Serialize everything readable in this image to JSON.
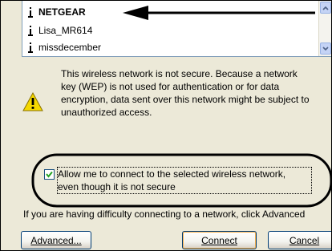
{
  "networks": [
    {
      "name": "NETGEAR",
      "selected": true
    },
    {
      "name": "Lisa_MR614",
      "selected": false
    },
    {
      "name": "missdecember",
      "selected": false
    }
  ],
  "warning": {
    "icon": "warning-icon",
    "text": "This wireless network is not secure. Because a network\nkey (WEP) is not used for authentication or for data\nencryption, data sent over this network might be subject to\nunauthorized access."
  },
  "allow": {
    "checked": true,
    "label": "Allow me to connect to the selected wireless network,\neven though it is not secure"
  },
  "help_text": "If you are having difficulty connecting to a network, click Advanced",
  "buttons": {
    "advanced": "Advanced...",
    "connect": "Connect",
    "cancel": "Cancel"
  },
  "colors": {
    "dialog_bg": "#ece9d8",
    "list_border": "#7f9db9",
    "button_border": "#003c74",
    "default_button_glow": "#f9b24d",
    "warning_yellow": "#f5d800"
  }
}
